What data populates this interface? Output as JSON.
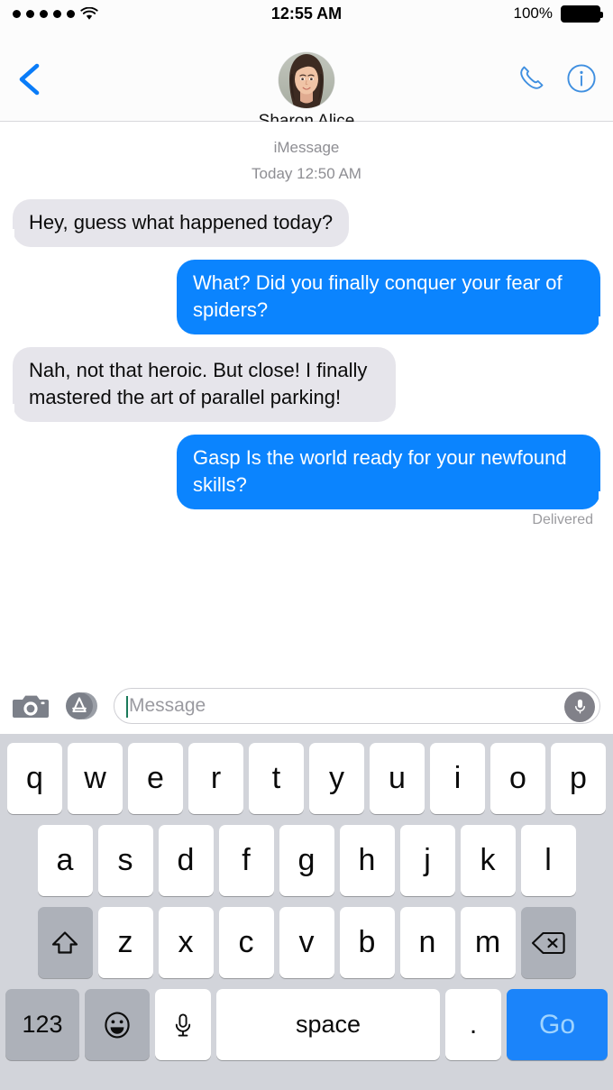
{
  "status_bar": {
    "signal_dots": 5,
    "wifi_icon": "wifi-icon",
    "time": "12:55 AM",
    "battery_percent": "100%",
    "battery_icon": "battery-full-icon"
  },
  "nav": {
    "back_icon": "chevron-left-icon",
    "contact_name": "Sharon Alice",
    "avatar_icon": "contact-avatar",
    "call_icon": "phone-icon",
    "info_icon": "info-circle-icon"
  },
  "conversation": {
    "service_label": "iMessage",
    "timestamp": "Today 12:50 AM",
    "messages": [
      {
        "side": "in",
        "text": "Hey, guess what happened today?"
      },
      {
        "side": "out",
        "text": "What? Did you finally conquer your fear of spiders?"
      },
      {
        "side": "in",
        "text": "Nah, not that heroic. But close! I finally mastered the art of parallel parking!"
      },
      {
        "side": "out",
        "text": "Gasp Is the world ready for your newfound skills?"
      }
    ],
    "delivery_status": "Delivered"
  },
  "input_bar": {
    "camera_icon": "camera-icon",
    "appstore_icon": "app-store-icon",
    "placeholder": "Message",
    "value": "",
    "mic_icon": "microphone-icon"
  },
  "keyboard": {
    "row1": [
      "q",
      "w",
      "e",
      "r",
      "t",
      "y",
      "u",
      "i",
      "o",
      "p"
    ],
    "row2": [
      "a",
      "s",
      "d",
      "f",
      "g",
      "h",
      "j",
      "k",
      "l"
    ],
    "row3": [
      "z",
      "x",
      "c",
      "v",
      "b",
      "n",
      "m"
    ],
    "shift_icon": "shift-up-arrow-icon",
    "backspace_icon": "backspace-delete-icon",
    "numeric_label": "123",
    "emoji_icon": "smiley-face-icon",
    "dictation_icon": "microphone-icon",
    "space_label": "space",
    "period_label": ".",
    "return_label": "Go"
  },
  "colors": {
    "accent_blue": "#0b84fe",
    "outgoing_bubble": "#0b84fe",
    "incoming_bubble": "#e6e5eb",
    "keyboard_bg": "#d2d4da",
    "key_white": "#ffffff",
    "key_gray": "#adb1b9",
    "go_button": "#1b84fa",
    "muted_text": "#8e8e93"
  }
}
